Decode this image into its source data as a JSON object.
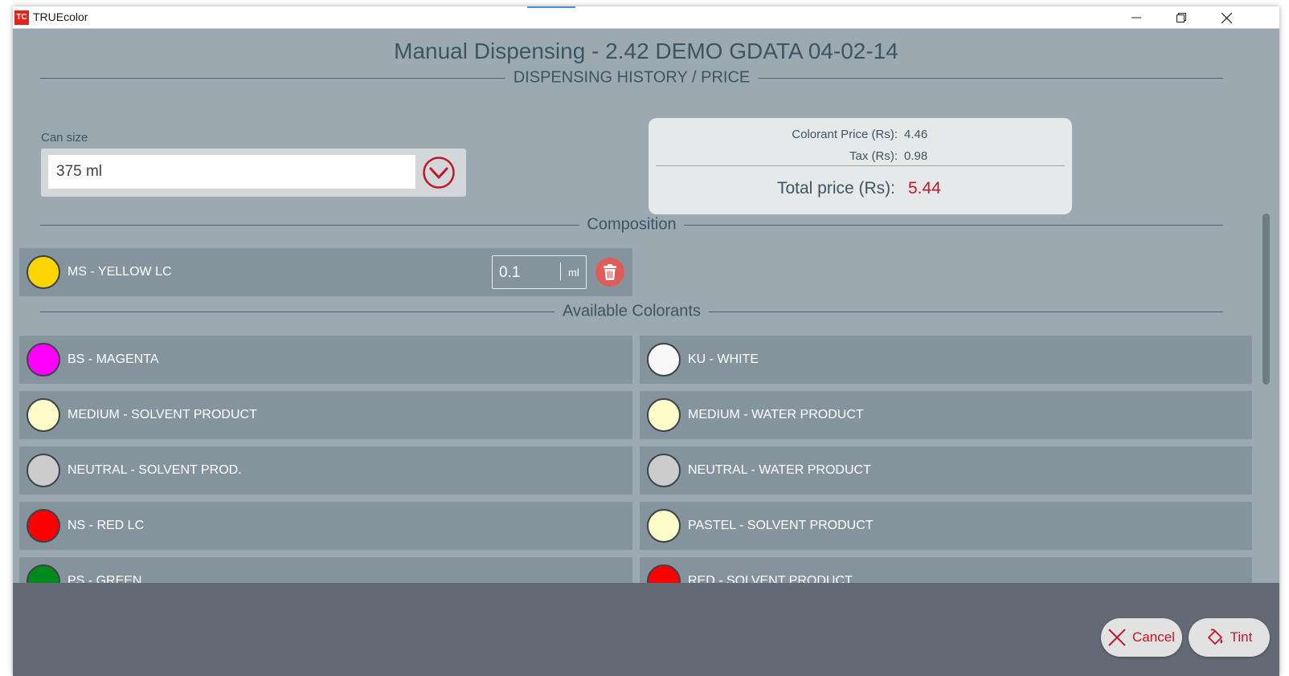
{
  "window": {
    "app_title": "TRUEcolor",
    "logo_text": "TC"
  },
  "page": {
    "title": "Manual Dispensing - 2.42  DEMO GDATA 04-02-14"
  },
  "sections": {
    "history": "DISPENSING HISTORY / PRICE",
    "composition": "Composition",
    "available": "Available Colorants"
  },
  "can_size": {
    "label": "Can size",
    "value": "375 ml"
  },
  "price": {
    "colorant_label": "Colorant Price (Rs):",
    "colorant_value": "4.46",
    "tax_label": "Tax (Rs):",
    "tax_value": "0.98",
    "total_label": "Total price (Rs):",
    "total_value": "5.44"
  },
  "composition": [
    {
      "name": "MS - YELLOW LC",
      "color": "#ffd500",
      "amount": "0.1",
      "unit": "ml"
    }
  ],
  "colorants": [
    {
      "name": "BS - MAGENTA",
      "color": "#ff00ff"
    },
    {
      "name": "KU - WHITE",
      "color": "#f8f8f8"
    },
    {
      "name": "MEDIUM - SOLVENT PRODUCT",
      "color": "#fcfdc9"
    },
    {
      "name": "MEDIUM - WATER PRODUCT",
      "color": "#fcfdc9"
    },
    {
      "name": "NEUTRAL - SOLVENT PROD.",
      "color": "#cccccc"
    },
    {
      "name": "NEUTRAL - WATER PRODUCT",
      "color": "#cccccc"
    },
    {
      "name": "NS - RED LC",
      "color": "#ff0000"
    },
    {
      "name": "PASTEL - SOLVENT PRODUCT",
      "color": "#fcfdc9"
    },
    {
      "name": "PS - GREEN",
      "color": "#008a1c"
    },
    {
      "name": "RED - SOLVENT PRODUCT",
      "color": "#ff0000"
    }
  ],
  "buttons": {
    "cancel": "Cancel",
    "tint": "Tint"
  },
  "colors": {
    "accent": "#c0172a",
    "background": "#9ca9b1",
    "footer": "#626a75"
  }
}
